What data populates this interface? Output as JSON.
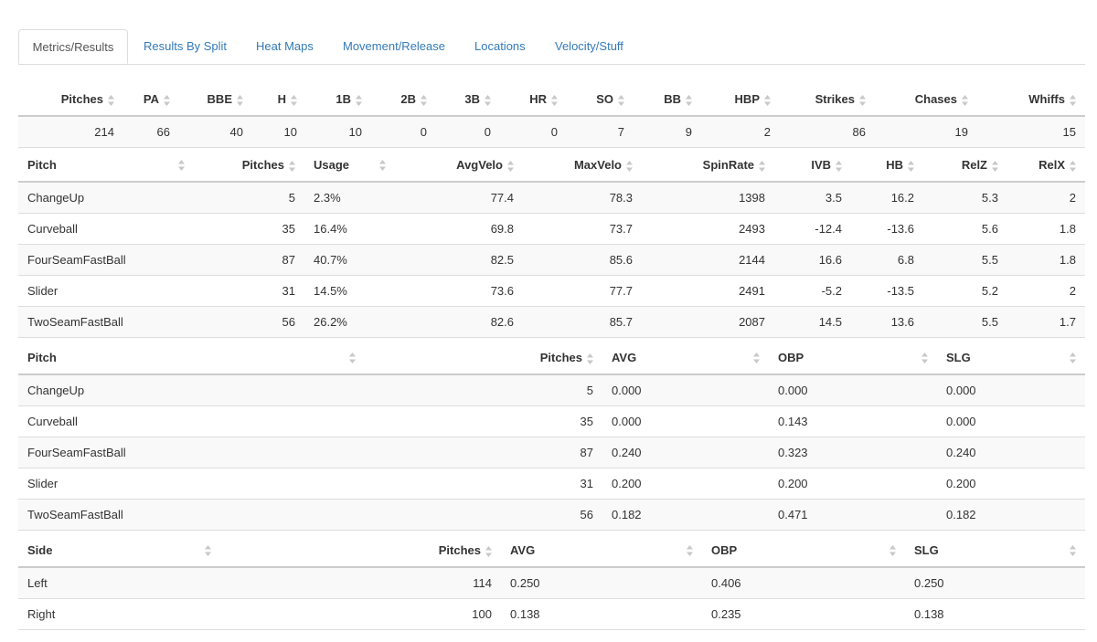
{
  "tabs": [
    "Metrics/Results",
    "Results By Split",
    "Heat Maps",
    "Movement/Release",
    "Locations",
    "Velocity/Stuff"
  ],
  "summary": {
    "headers": [
      "Pitches",
      "PA",
      "BBE",
      "H",
      "1B",
      "2B",
      "3B",
      "HR",
      "SO",
      "BB",
      "HBP",
      "Strikes",
      "Chases",
      "Whiffs"
    ],
    "values": [
      "214",
      "66",
      "40",
      "10",
      "10",
      "0",
      "0",
      "0",
      "7",
      "9",
      "2",
      "86",
      "19",
      "15"
    ]
  },
  "pitch_metrics": {
    "headers": [
      "Pitch",
      "Pitches",
      "Usage",
      "AvgVelo",
      "MaxVelo",
      "SpinRate",
      "IVB",
      "HB",
      "RelZ",
      "RelX"
    ],
    "rows": [
      [
        "ChangeUp",
        "5",
        "2.3%",
        "77.4",
        "78.3",
        "1398",
        "3.5",
        "16.2",
        "5.3",
        "2"
      ],
      [
        "Curveball",
        "35",
        "16.4%",
        "69.8",
        "73.7",
        "2493",
        "-12.4",
        "-13.6",
        "5.6",
        "1.8"
      ],
      [
        "FourSeamFastBall",
        "87",
        "40.7%",
        "82.5",
        "85.6",
        "2144",
        "16.6",
        "6.8",
        "5.5",
        "1.8"
      ],
      [
        "Slider",
        "31",
        "14.5%",
        "73.6",
        "77.7",
        "2491",
        "-5.2",
        "-13.5",
        "5.2",
        "2"
      ],
      [
        "TwoSeamFastBall",
        "56",
        "26.2%",
        "82.6",
        "85.7",
        "2087",
        "14.5",
        "13.6",
        "5.5",
        "1.7"
      ]
    ]
  },
  "pitch_results": {
    "headers": [
      "Pitch",
      "Pitches",
      "AVG",
      "OBP",
      "SLG"
    ],
    "rows": [
      [
        "ChangeUp",
        "5",
        "0.000",
        "0.000",
        "0.000"
      ],
      [
        "Curveball",
        "35",
        "0.000",
        "0.143",
        "0.000"
      ],
      [
        "FourSeamFastBall",
        "87",
        "0.240",
        "0.323",
        "0.240"
      ],
      [
        "Slider",
        "31",
        "0.200",
        "0.200",
        "0.200"
      ],
      [
        "TwoSeamFastBall",
        "56",
        "0.182",
        "0.471",
        "0.182"
      ]
    ]
  },
  "side_results": {
    "headers": [
      "Side",
      "Pitches",
      "AVG",
      "OBP",
      "SLG"
    ],
    "rows": [
      [
        "Left",
        "114",
        "0.250",
        "0.406",
        "0.250"
      ],
      [
        "Right",
        "100",
        "0.138",
        "0.235",
        "0.138"
      ]
    ]
  },
  "colors": {
    "link": "#337ab7",
    "border": "#dddddd",
    "stripe": "#f9f9f9",
    "sort_icon": "#c8c8c8"
  },
  "icons": {
    "sort": "sort-arrows-icon"
  }
}
